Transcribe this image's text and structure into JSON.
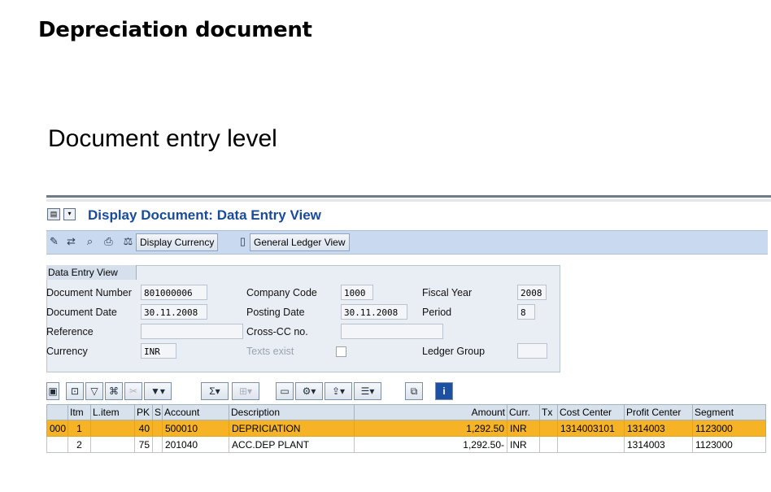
{
  "slide": {
    "title": "Depreciation document",
    "subtitle": "Document entry level"
  },
  "screen": {
    "title": "Display Document: Data Entry View"
  },
  "toolbar": {
    "display_currency": "Display Currency",
    "general_ledger_view": "General Ledger View",
    "icons": [
      "edit-icon",
      "change-icon",
      "search-icon",
      "print-icon",
      "currency-icon",
      "ledger-icon"
    ]
  },
  "panel": {
    "tab_label": "Data Entry View",
    "document_number_label": "Document Number",
    "document_number": "801000006",
    "document_date_label": "Document Date",
    "document_date": "30.11.2008",
    "reference_label": "Reference",
    "reference": "",
    "currency_label": "Currency",
    "currency": "INR",
    "company_code_label": "Company Code",
    "company_code": "1000",
    "posting_date_label": "Posting Date",
    "posting_date": "30.11.2008",
    "cross_cc_label": "Cross-CC no.",
    "cross_cc": "",
    "texts_exist_label": "Texts exist",
    "fiscal_year_label": "Fiscal Year",
    "fiscal_year": "2008",
    "period_label": "Period",
    "period": "8",
    "ledger_group_label": "Ledger Group",
    "ledger_group": ""
  },
  "grid": {
    "columns": [
      "",
      "Itm",
      "L.item",
      "PK",
      "S",
      "Account",
      "Description",
      "Amount",
      "Curr.",
      "Tx",
      "Cost Center",
      "Profit Center",
      "Segment"
    ],
    "rows": [
      [
        "000",
        "1",
        "",
        "40",
        "",
        "500010",
        "DEPRICIATION",
        "1,292.50",
        "INR",
        "",
        "1314003101",
        "1314003",
        "1123000"
      ],
      [
        "",
        "2",
        "",
        "75",
        "",
        "201040",
        "ACC.DEP PLANT",
        "1,292.50-",
        "INR",
        "",
        "",
        "1314003",
        "1123000"
      ]
    ],
    "selected_row": 0
  }
}
